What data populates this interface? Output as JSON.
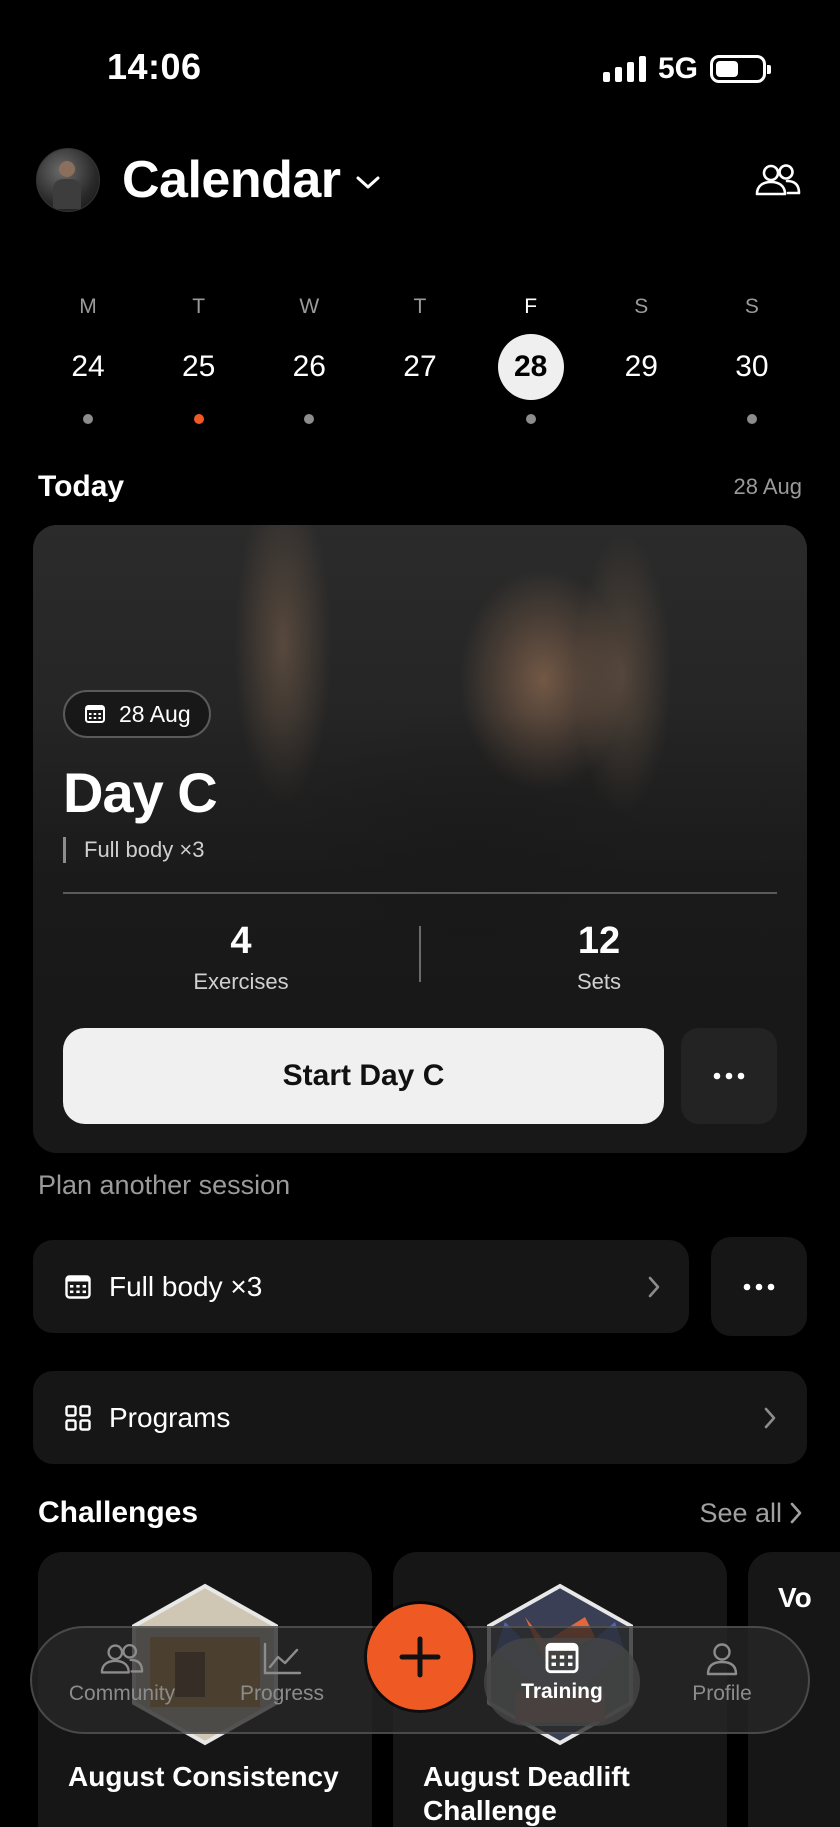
{
  "status_bar": {
    "time": "14:06",
    "network": "5G",
    "battery_level": 0.5
  },
  "header": {
    "title": "Calendar"
  },
  "week": [
    {
      "letter": "M",
      "num": "24",
      "dot": "grey"
    },
    {
      "letter": "T",
      "num": "25",
      "dot": "accent"
    },
    {
      "letter": "W",
      "num": "26",
      "dot": "grey"
    },
    {
      "letter": "T",
      "num": "27",
      "dot": "none"
    },
    {
      "letter": "F",
      "num": "28",
      "dot": "grey",
      "selected": true
    },
    {
      "letter": "S",
      "num": "29",
      "dot": "none"
    },
    {
      "letter": "S",
      "num": "30",
      "dot": "grey"
    }
  ],
  "today": {
    "title": "Today",
    "date": "28 Aug",
    "card": {
      "date_chip": "28 Aug",
      "title": "Day C",
      "subtitle": "Full body ×3",
      "stats": [
        {
          "value": "4",
          "label": "Exercises"
        },
        {
          "value": "12",
          "label": "Sets"
        }
      ],
      "start_label": "Start Day C"
    }
  },
  "plan": {
    "label": "Plan another session",
    "program_row": "Full body ×3",
    "programs_row": "Programs"
  },
  "challenges": {
    "title": "Challenges",
    "see_all": "See all",
    "items": [
      {
        "title": "August Consistency"
      },
      {
        "title": "August Deadlift Challenge"
      },
      {
        "title": "Vo"
      }
    ]
  },
  "nav": {
    "community": "Community",
    "progress": "Progress",
    "training": "Training",
    "profile": "Profile"
  },
  "colors": {
    "accent": "#ef5a24",
    "background": "#000000",
    "card": "#161616"
  }
}
